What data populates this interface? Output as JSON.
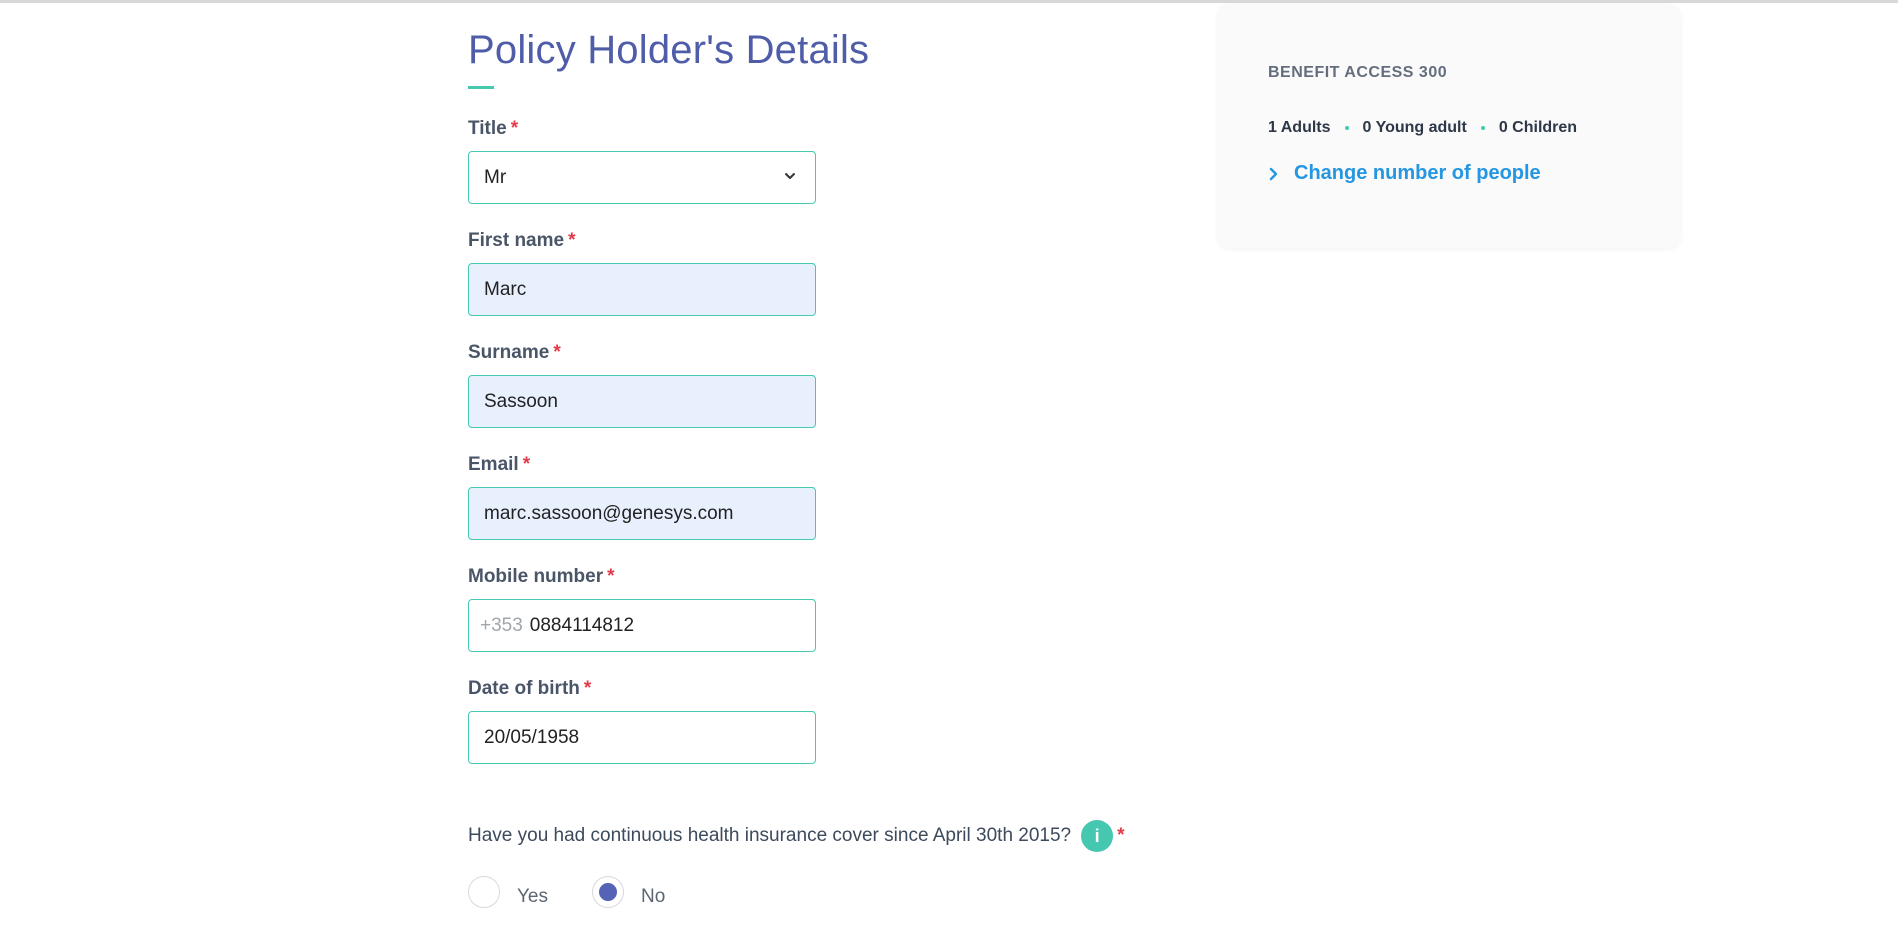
{
  "form": {
    "heading": "Policy Holder's Details",
    "required_mark": "*",
    "fields": {
      "title": {
        "label": "Title",
        "value": "Mr"
      },
      "first_name": {
        "label": "First name",
        "value": "Marc"
      },
      "surname": {
        "label": "Surname",
        "value": "Sassoon"
      },
      "email": {
        "label": "Email",
        "value": "marc.sassoon@genesys.com"
      },
      "mobile": {
        "label": "Mobile number",
        "prefix": "+353",
        "value": "0884114812"
      },
      "dob": {
        "label": "Date of birth",
        "value": "20/05/1958"
      }
    },
    "question": {
      "text": "Have you had continuous health insurance cover since April 30th 2015?",
      "info_glyph": "i",
      "options": {
        "yes": "Yes",
        "no": "No"
      },
      "selected": "No"
    }
  },
  "summary_card": {
    "plan": "BENEFIT ACCESS 300",
    "adults": "1 Adults",
    "young_adults": "0 Young adult",
    "children": "0 Children",
    "change_link": "Change number of people"
  },
  "colors": {
    "heading": "#4f5da8",
    "accent": "#45c7b0",
    "link": "#2496e2",
    "required": "#e23b4a",
    "radio_selected": "#5563b7",
    "autofill_bg": "#e8f0fe"
  },
  "icons": {
    "title_select": "chevron-down-icon",
    "info": "info-icon",
    "change_link": "chevron-right-icon"
  }
}
